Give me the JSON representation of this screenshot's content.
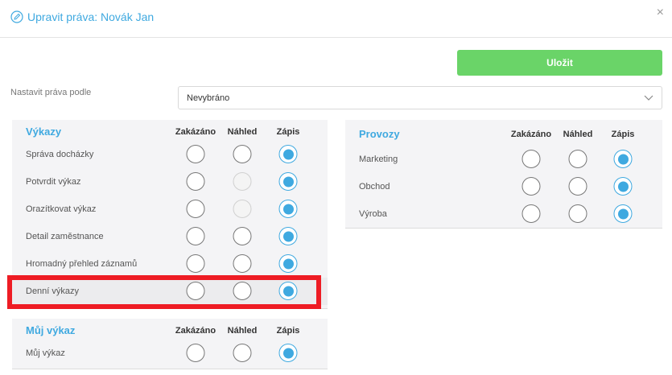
{
  "header": {
    "title": "Upravit práva: Novák Jan",
    "title_icon": "pencil-circle-icon",
    "close_glyph": "×"
  },
  "toolbar": {
    "save_label": "Uložit",
    "save_color": "#6ad468"
  },
  "setby": {
    "label": "Nastavit práva podle",
    "value": "Nevybráno"
  },
  "columns": {
    "forbidden": "Zakázáno",
    "preview": "Náhled",
    "write": "Zápis"
  },
  "vykazy": {
    "title": "Výkazy",
    "rows": [
      {
        "label": "Správa docházky",
        "selected": "write",
        "preview_disabled": false
      },
      {
        "label": "Potvrdit výkaz",
        "selected": "write",
        "preview_disabled": true
      },
      {
        "label": "Orazítkovat výkaz",
        "selected": "write",
        "preview_disabled": true
      },
      {
        "label": "Detail zaměstnance",
        "selected": "write",
        "preview_disabled": false
      },
      {
        "label": "Hromadný přehled záznamů",
        "selected": "write",
        "preview_disabled": false
      },
      {
        "label": "Denní výkazy",
        "selected": "write",
        "preview_disabled": false
      }
    ]
  },
  "muj_vykaz": {
    "title": "Můj výkaz",
    "rows": [
      {
        "label": "Můj výkaz",
        "selected": "write",
        "preview_disabled": false
      }
    ]
  },
  "provozy": {
    "title": "Provozy",
    "rows": [
      {
        "label": "Marketing",
        "selected": "write",
        "preview_disabled": false
      },
      {
        "label": "Obchod",
        "selected": "write",
        "preview_disabled": false
      },
      {
        "label": "Výroba",
        "selected": "write",
        "preview_disabled": false
      }
    ]
  },
  "colors": {
    "accent": "#3fa9e0",
    "highlight_border": "#ee1c24"
  }
}
